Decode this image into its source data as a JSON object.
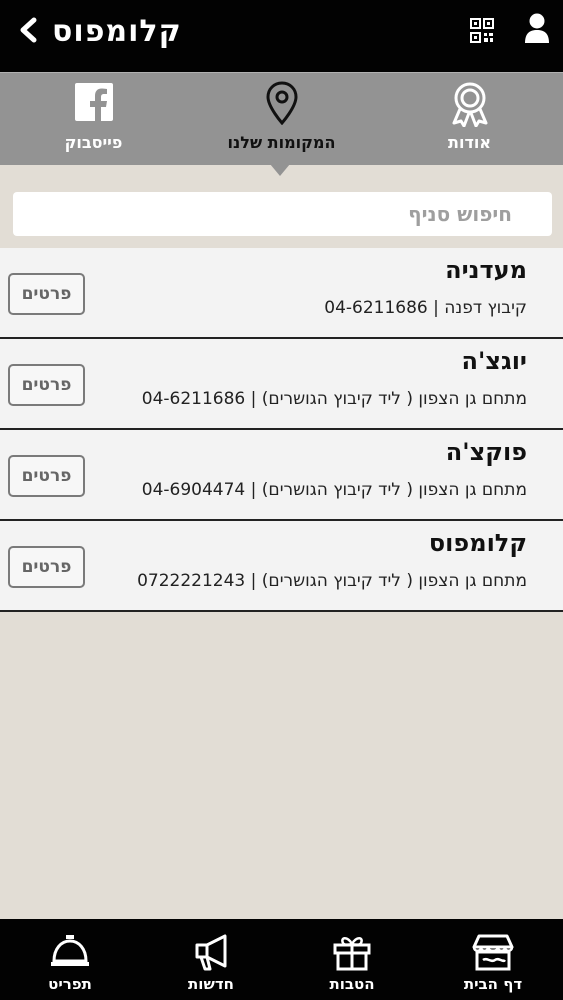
{
  "header": {
    "title": "קלומפוס",
    "back_icon": "chevron-left-icon",
    "qr_icon": "qr-code-icon",
    "user_icon": "user-icon"
  },
  "tabs": [
    {
      "label": "פייסבוק",
      "icon": "facebook-icon"
    },
    {
      "label": "המקומות שלנו",
      "icon": "location-pin-icon",
      "active": true
    },
    {
      "label": "אודות",
      "icon": "award-ribbon-icon"
    }
  ],
  "search": {
    "placeholder": "חיפוש סניף",
    "value": ""
  },
  "branches": [
    {
      "name": "מעדניה",
      "location": "קיבוץ דפנה",
      "phone": "04-6211686",
      "button": "פרטים"
    },
    {
      "name": "יוגצ'ה",
      "location": "מתחם גן הצפון ( ליד קיבוץ הגושרים)",
      "phone": "04-6211686",
      "button": "פרטים"
    },
    {
      "name": "פוקצ'ה",
      "location": "מתחם גן הצפון ( ליד קיבוץ הגושרים)",
      "phone": "04-6904474",
      "button": "פרטים"
    },
    {
      "name": "קלומפוס",
      "location": "מתחם גן הצפון ( ליד קיבוץ הגושרים)",
      "phone": "0722221243",
      "button": "פרטים"
    }
  ],
  "bottom_nav": [
    {
      "label": "תפריט",
      "icon": "service-bell-icon"
    },
    {
      "label": "חדשות",
      "icon": "megaphone-icon"
    },
    {
      "label": "הטבות",
      "icon": "gift-icon"
    },
    {
      "label": "דף הבית",
      "icon": "store-icon"
    }
  ],
  "colors": {
    "topbar": "#020202",
    "tabs_bg": "#939393",
    "page_bg": "#e2ddd5",
    "list_bg": "#f3f3f3"
  }
}
